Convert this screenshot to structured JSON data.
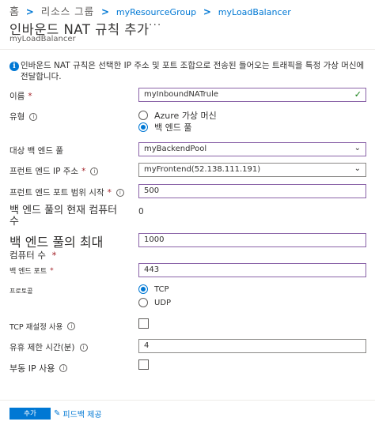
{
  "breadcrumb": {
    "home": "홈",
    "separator": ">",
    "resource_group_label": "리소스 그룹",
    "resource_group": "myResourceGroup",
    "load_balancer": "myLoadBalancer"
  },
  "header": {
    "title": "인바운드 NAT 규칙 추가",
    "more": "···",
    "subtitle": "myLoadBalancer"
  },
  "info": {
    "icon": "i",
    "text": "인바운드 NAT 규칙은 선택한 IP 주소 및 포트 조합으로 전송된 들어오는 트래픽을 특정 가상 머신에 전달합니다."
  },
  "form": {
    "name": {
      "label": "이름",
      "required": "*",
      "value": "myInboundNATrule",
      "valid_mark": "✓"
    },
    "type": {
      "label": "유형",
      "options": [
        {
          "label": "Azure 가상 머신",
          "selected": false
        },
        {
          "label": "백 엔드 풀",
          "selected": true
        }
      ]
    },
    "target_pool": {
      "label": "대상 백 엔드 풀",
      "value": "myBackendPool"
    },
    "frontend_ip": {
      "label": "프런트 엔드 IP 주소",
      "required": "*",
      "value": "myFrontend(52.138.111.191)"
    },
    "frontend_port_start": {
      "label": "프런트 엔드 포트 범위 시작",
      "required": "*",
      "value": "500"
    },
    "current_count": {
      "label_line1": "백 엔드 풀의 현재 컴퓨터",
      "label_line2": "수",
      "value": "0"
    },
    "max_count": {
      "label_line1": "백 엔드 풀의 최대",
      "label_line2": "컴퓨터 수",
      "required": "*",
      "value": "1000"
    },
    "backend_port": {
      "label": "백 엔드 포트",
      "required": "*",
      "value": "443"
    },
    "protocol": {
      "label": "프로토콜",
      "options": [
        {
          "label": "TCP",
          "selected": true
        },
        {
          "label": "UDP",
          "selected": false
        }
      ]
    },
    "tcp_reset": {
      "label": "TCP 재설정 사용",
      "checked": false
    },
    "idle_timeout": {
      "label": "유휴 제한 시간(분)",
      "value": "4"
    },
    "floating_ip": {
      "label": "부동 IP 사용",
      "checked": false
    }
  },
  "footer": {
    "add_button": "추가",
    "feedback_label": "피드백 제공"
  },
  "colors": {
    "accent": "#0078d4",
    "required": "#a4262c",
    "valid": "#107c10",
    "selected_border": "#8a63a8"
  },
  "icons": {
    "info": "info-icon",
    "help": "help-icon",
    "chevron": "chevron-down-icon",
    "check": "checkmark-icon",
    "feedback": "feedback-icon"
  }
}
